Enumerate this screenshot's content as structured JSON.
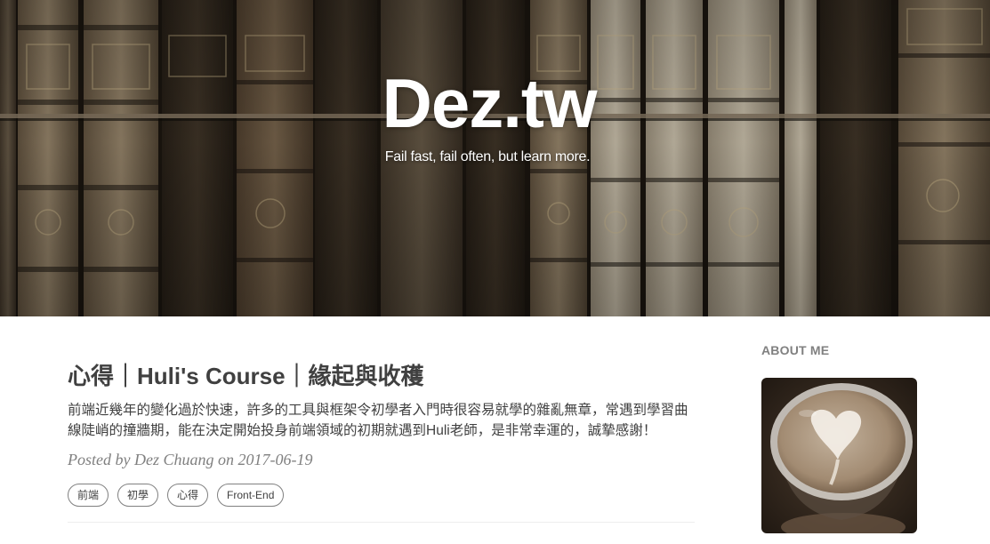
{
  "header": {
    "title": "Dez.tw",
    "subtitle": "Fail fast, fail often, but learn more."
  },
  "post": {
    "title": "心得｜Huli's Course｜緣起與收穫",
    "excerpt": "前端近幾年的變化過於快速，許多的工具與框架令初學者入門時很容易就學的雜亂無章，常遇到學習曲線陡峭的撞牆期，能在決定開始投身前端領域的初期就遇到Huli老師，是非常幸運的，誠摯感謝！",
    "meta_prefix": "Posted by ",
    "author": "Dez Chuang",
    "meta_on": " on ",
    "date": "2017-06-19",
    "tags": [
      "前端",
      "初學",
      "心得",
      "Front-End"
    ]
  },
  "sidebar": {
    "about_heading": "ABOUT ME",
    "avatar_icon": "latte-art-heart-photo"
  },
  "colors": {
    "text": "#404040",
    "muted": "#808080",
    "hero_dark": "#1e1912"
  }
}
